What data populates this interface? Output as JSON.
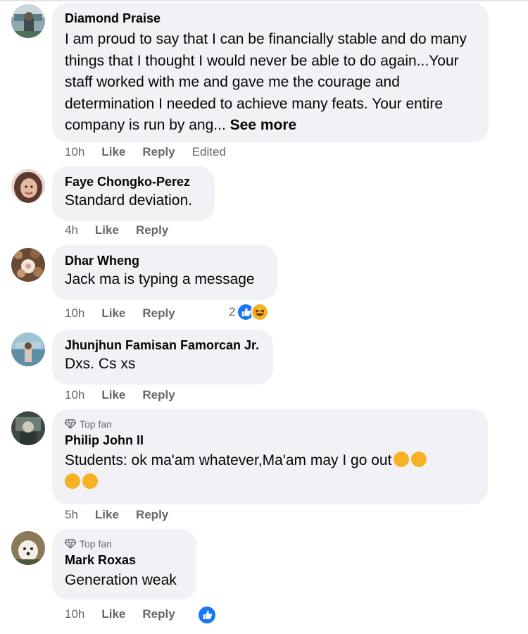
{
  "colors": {
    "bubble_bg": "#f0f2f5",
    "meta_text": "#65676b",
    "like_blue": "#1877f2",
    "haha_yellow": "#f7b125"
  },
  "comments": [
    {
      "author": "Diamond Praise",
      "text": "I am proud to say that I can be financially stable and do many things that I thought I would never be able to do again...Your staff worked with me and gave me the courage and determination I needed to achieve many feats. Your entire company is run by ang...",
      "see_more": "See more",
      "time": "10h",
      "like": "Like",
      "reply": "Reply",
      "edited": "Edited",
      "avatar_icon": "profile-photo"
    },
    {
      "author": "Faye Chongko-Perez",
      "text": "Standard deviation.",
      "time": "4h",
      "like": "Like",
      "reply": "Reply",
      "avatar_icon": "profile-photo"
    },
    {
      "author": "Dhar Wheng",
      "text": "Jack ma is typing a message",
      "time": "10h",
      "like": "Like",
      "reply": "Reply",
      "reaction_count": "2",
      "reactions": [
        "like-icon",
        "haha-icon"
      ],
      "avatar_icon": "profile-photo"
    },
    {
      "author": "Jhunjhun Famisan Famorcan Jr.",
      "text": "Dxs. Cs xs",
      "time": "10h",
      "like": "Like",
      "reply": "Reply",
      "avatar_icon": "profile-photo"
    },
    {
      "badge": "Top fan",
      "author": "Philip John II",
      "text": "Students: ok ma'am whatever,Ma'am may I go out",
      "text_emojis": [
        "rofl-emoji",
        "rofl-emoji",
        "rofl-emoji",
        "astonished-emoji"
      ],
      "time": "5h",
      "like": "Like",
      "reply": "Reply",
      "avatar_icon": "profile-photo"
    },
    {
      "badge": "Top fan",
      "author": "Mark Roxas",
      "text": "Generation weak",
      "time": "10h",
      "like": "Like",
      "reply": "Reply",
      "reactions": [
        "like-icon"
      ],
      "avatar_icon": "profile-photo"
    }
  ]
}
